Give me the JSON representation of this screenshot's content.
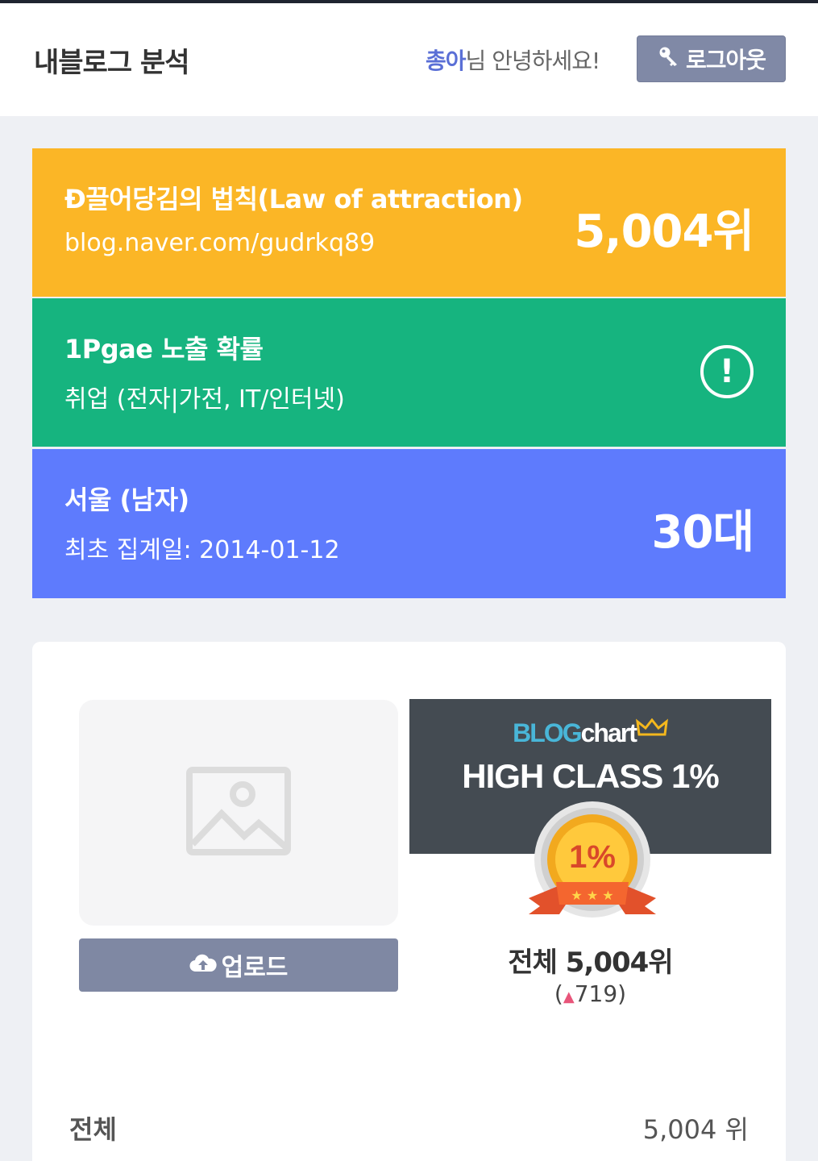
{
  "header": {
    "title": "내블로그 분석",
    "greeting_user": "총아",
    "greeting_suffix": "님 안녕하세요!",
    "logout_label": "로그아웃"
  },
  "cards": {
    "blog": {
      "name": "Ð끌어당김의 법칙(Law of attraction)",
      "url": "blog.naver.com/gudrkq89",
      "rank": "5,004위",
      "color": "#fbb626"
    },
    "exposure": {
      "title": "1Pgae 노출 확률",
      "category": "취업 (전자|가전, IT/인터넷)",
      "icon": "exclamation-circle-icon",
      "color": "#16b47f"
    },
    "profile": {
      "region": "서울 (남자)",
      "first_date": "최초 집계일: 2014-01-12",
      "age": "30대",
      "color": "#5e7bfd"
    }
  },
  "panel": {
    "upload_label": "업로드",
    "badge": {
      "logo_blog": "BLOG",
      "logo_chart": "chart",
      "class_text": "HIGH CLASS 1%",
      "medal_text": "1%"
    },
    "total_rank": "전체 5,004위",
    "change_open": "(",
    "change_arrow": "▲",
    "change_value": "719)",
    "row_label": "전체",
    "row_value": "5,004 위"
  }
}
